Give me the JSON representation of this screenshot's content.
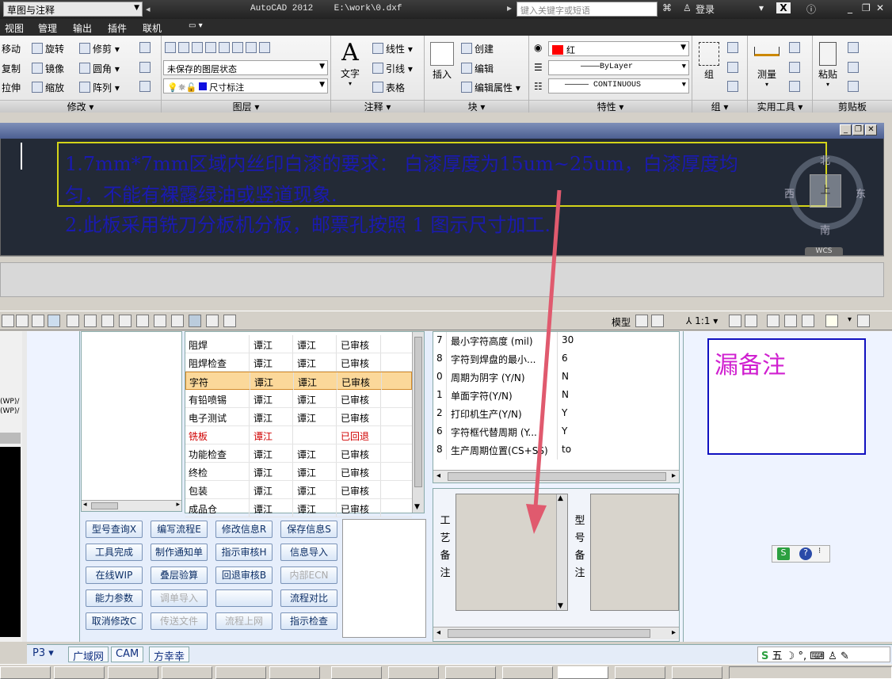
{
  "titlebar": {
    "workspace": "草图与注释",
    "app_title": "AutoCAD 2012",
    "file_path": "E:\\work\\0.dxf",
    "search_placeholder": "键入关键字或短语",
    "login": "登录"
  },
  "menu": [
    "视图",
    "管理",
    "输出",
    "插件",
    "联机"
  ],
  "ribbon": {
    "modify": {
      "title": "修改",
      "items": [
        "移动",
        "旋转",
        "修剪",
        "复制",
        "镜像",
        "圆角",
        "拉伸",
        "缩放",
        "阵列"
      ]
    },
    "layers": {
      "title": "图层",
      "layer_state": "未保存的图层状态",
      "current_layer": "尺寸标注"
    },
    "annotation": {
      "title": "注释",
      "text": "文字",
      "linear": "线性",
      "leader": "引线",
      "table": "表格"
    },
    "block": {
      "title": "块",
      "insert": "插入",
      "create": "创建",
      "edit": "编辑",
      "edit_attr": "编辑属性"
    },
    "properties": {
      "title": "特性",
      "color": "红",
      "linetype1": "ByLayer",
      "linetype2": "CONTINUOUS"
    },
    "groups": {
      "title": "组",
      "group": "组"
    },
    "utilities": {
      "title": "实用工具",
      "measure": "测量"
    },
    "clipboard": {
      "title": "剪贴板",
      "paste": "粘贴"
    }
  },
  "drawing": {
    "note_line1": "1.7mm*7mm区域内丝印白漆的要求：  白漆厚度为15um~25um，白漆厚度均",
    "note_line2": "匀，不能有裸露绿油或竖道现象.",
    "note_line3": "2.此板采用铣刀分板机分板，邮票孔按照 1 图示尺寸加工.",
    "compass": {
      "north": "北",
      "south": "南",
      "west": "西",
      "east": "东",
      "top": "上",
      "wcs": "WCS"
    }
  },
  "statusbar": {
    "model": "模型",
    "scale": "1:1"
  },
  "left_strip": {
    "labels": [
      "(WP)/",
      "(WP)/"
    ]
  },
  "process_grid": {
    "rows": [
      {
        "step": "阻焊",
        "a": "谭江",
        "b": "谭江",
        "status": "已审核"
      },
      {
        "step": "阻焊检查",
        "a": "谭江",
        "b": "谭江",
        "status": "已审核"
      },
      {
        "step": "字符",
        "a": "谭江",
        "b": "谭江",
        "status": "已审核"
      },
      {
        "step": "有铅喷锡",
        "a": "谭江",
        "b": "谭江",
        "status": "已审核"
      },
      {
        "step": "电子测试",
        "a": "谭江",
        "b": "谭江",
        "status": "已审核"
      },
      {
        "step": "铣板",
        "a": "谭江",
        "b": "",
        "status": "已回退"
      },
      {
        "step": "功能检查",
        "a": "谭江",
        "b": "谭江",
        "status": "已审核"
      },
      {
        "step": "终检",
        "a": "谭江",
        "b": "谭江",
        "status": "已审核"
      },
      {
        "step": "包装",
        "a": "谭江",
        "b": "谭江",
        "status": "已审核"
      },
      {
        "step": "成品仓",
        "a": "谭江",
        "b": "谭江",
        "status": "已审核"
      }
    ]
  },
  "buttons": [
    [
      "型号查询X",
      "编写流程E",
      "修改信息R",
      "保存信息S"
    ],
    [
      "工具完成",
      "制作通知单",
      "指示审核H",
      "信息导入"
    ],
    [
      "在线WIP",
      "叠层验算",
      "回退审核B",
      "内部ECN"
    ],
    [
      "能力参数",
      "调单导入",
      "",
      "流程对比"
    ],
    [
      "取消修改C",
      "传送文件",
      "流程上网",
      "指示检查"
    ]
  ],
  "param_grid": {
    "rows": [
      {
        "n": "7",
        "name": "最小字符高度 (mil)",
        "value": "30"
      },
      {
        "n": "8",
        "name": "字符到焊盘的最小...",
        "value": "6"
      },
      {
        "n": "0",
        "name": "周期为阴字 (Y/N)",
        "value": "N"
      },
      {
        "n": "1",
        "name": "单面字符(Y/N)",
        "value": "N"
      },
      {
        "n": "2",
        "name": "打印机生产(Y/N)",
        "value": "Y"
      },
      {
        "n": "6",
        "name": "字符框代替周期 (Y...",
        "value": "Y"
      },
      {
        "n": "8",
        "name": "生产周期位置(CS+SS)",
        "value": "to"
      }
    ]
  },
  "remarks": {
    "process_label": [
      "工",
      "艺",
      "备",
      "注"
    ],
    "model_label": [
      "型",
      "号",
      "备",
      "注"
    ]
  },
  "missing_note": "漏备注",
  "tabs": [
    "P3",
    "广域网",
    "CAM",
    "方幸幸"
  ],
  "ime": {
    "mode": "五"
  },
  "colors": {
    "note_text": "#1a1ab0",
    "note_border": "#d4d419",
    "arrow": "#e05a6e",
    "missing_text": "#d020d0",
    "reverted": "#d00000"
  }
}
